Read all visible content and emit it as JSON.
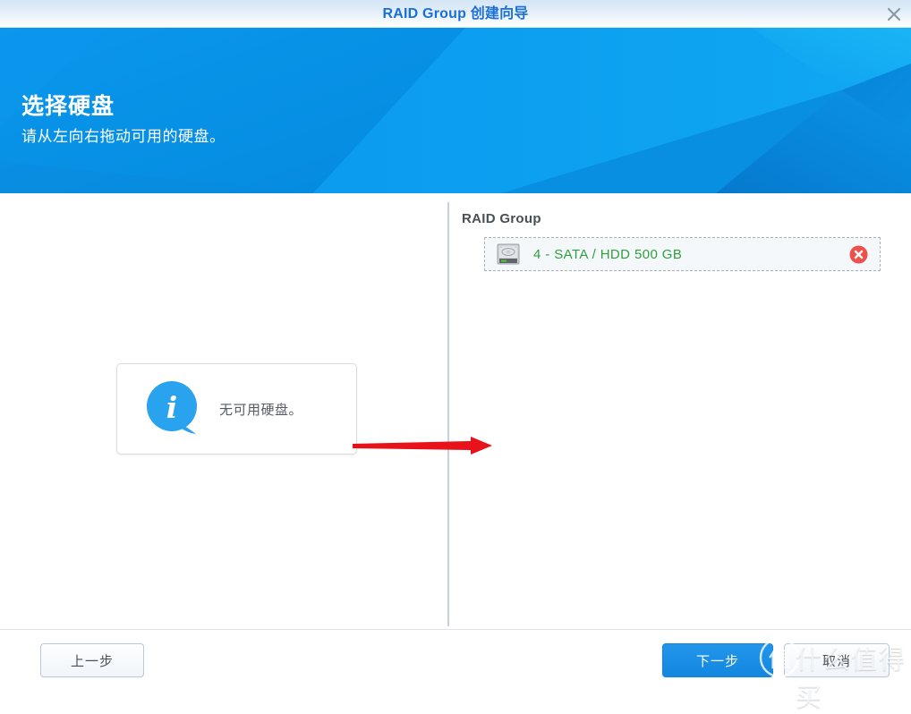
{
  "window": {
    "title": "RAID Group 创建向导",
    "close_icon": "close-icon"
  },
  "banner": {
    "title": "选择硬盘",
    "subtitle": "请从左向右拖动可用的硬盘。",
    "background_color": "#0591e8"
  },
  "left_pane": {
    "info_icon": "info-bubble-icon",
    "info_message": "无可用硬盘。"
  },
  "right_pane": {
    "group_label": "RAID Group",
    "disks": [
      {
        "icon": "hard-disk-icon",
        "label": "4 - SATA / HDD 500 GB",
        "text_color": "#2f9e3c",
        "remove_icon": "remove-circle-icon"
      }
    ]
  },
  "annotation": {
    "arrow_icon": "red-arrow-right-icon",
    "color": "#e8131a"
  },
  "footer": {
    "prev_label": "上一步",
    "next_label": "下一步",
    "cancel_label": "取消"
  },
  "watermark": {
    "logo_icon": "zhi-circle-logo-icon",
    "text": "什么值得买"
  }
}
